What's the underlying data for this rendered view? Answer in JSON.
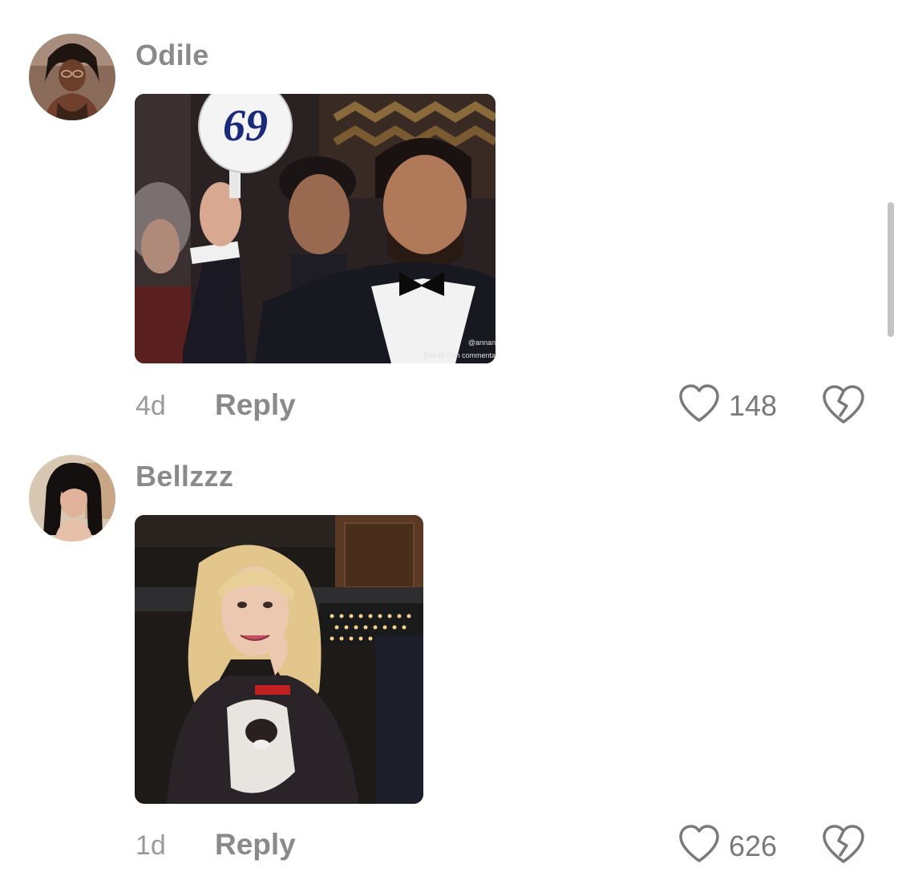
{
  "comments": [
    {
      "username": "Odile",
      "time": "4d",
      "reply_label": "Reply",
      "likes": "148",
      "avatar_icon": "user-avatar",
      "media": {
        "paddle_number": "69",
        "watermark_handle": "@annan",
        "watermark_caption": "Extrait d'un commenta"
      }
    },
    {
      "username": "Bellzzz",
      "time": "1d",
      "reply_label": "Reply",
      "likes": "626",
      "avatar_icon": "user-avatar"
    }
  ],
  "icons": {
    "like": "heart-outline-icon",
    "dislike": "broken-heart-icon"
  },
  "colors": {
    "text_muted": "#8a8a8a",
    "icon": "#7a7a7a",
    "scrollbar": "#c4c4c4"
  }
}
